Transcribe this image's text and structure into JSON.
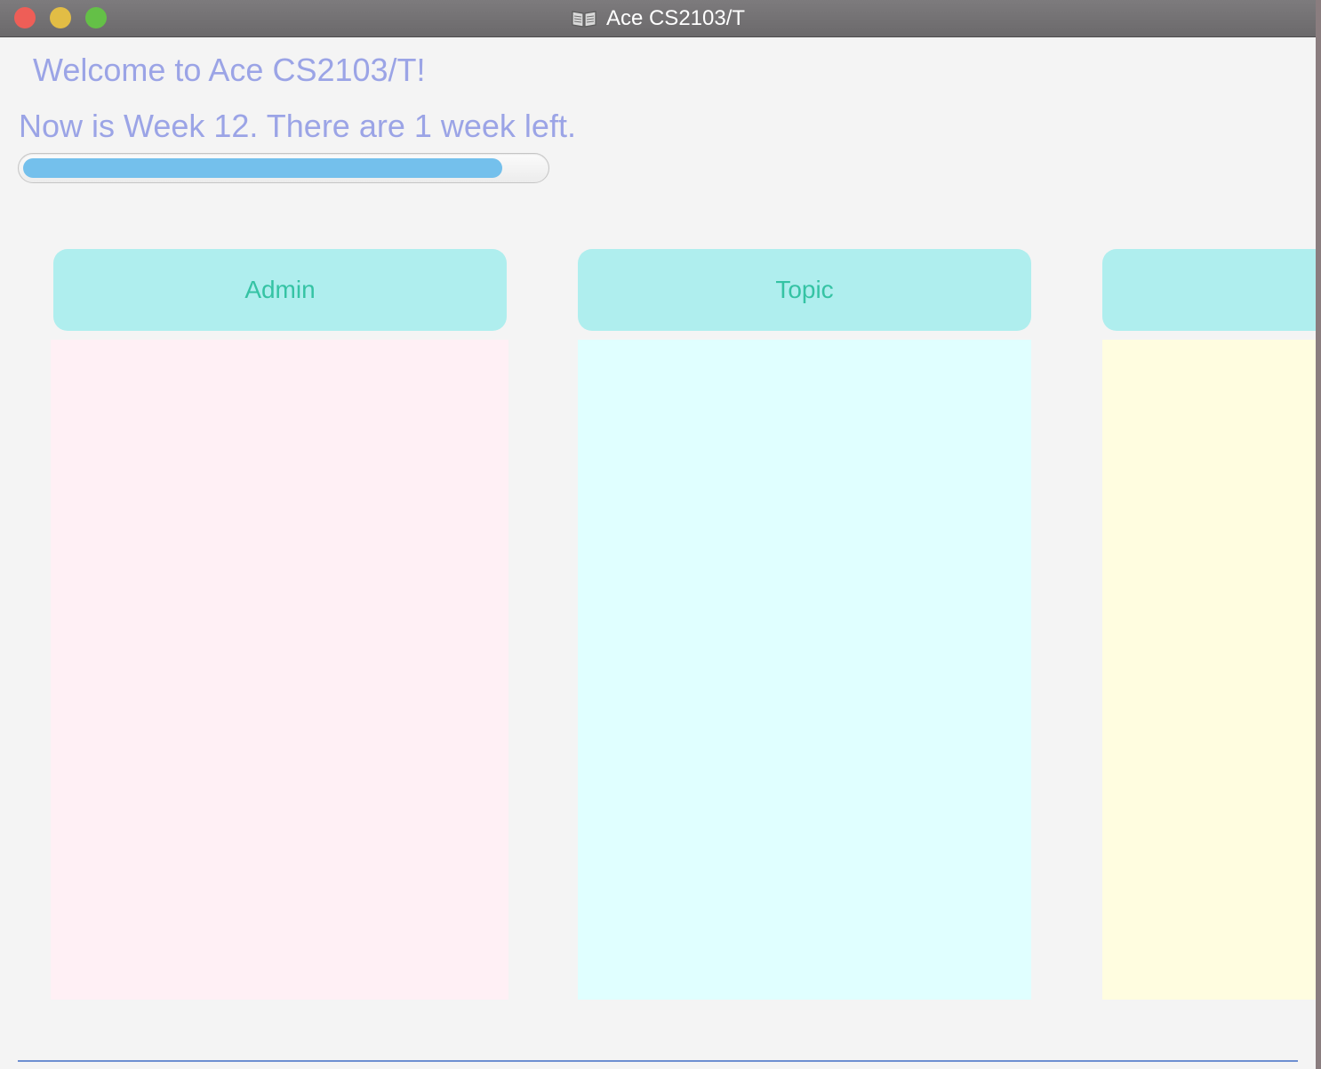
{
  "window": {
    "title": "Ace CS2103/T",
    "title_icon": "book-icon"
  },
  "main": {
    "welcome_text": "Welcome to Ace CS2103/T!",
    "week_text": "Now is Week 12. There are 1 week left.",
    "progress": {
      "value": 0.92
    },
    "columns": [
      {
        "label": "Admin",
        "color": "#fff0f5"
      },
      {
        "label": "Topic",
        "color": "#e0ffff"
      },
      {
        "label": "",
        "color": "#fffde0"
      }
    ],
    "colors": {
      "header_bg": "#afeeee",
      "header_text": "#35c3a4",
      "headline_text": "#9ba4e6",
      "progress_fill": "#74c0ec"
    }
  }
}
